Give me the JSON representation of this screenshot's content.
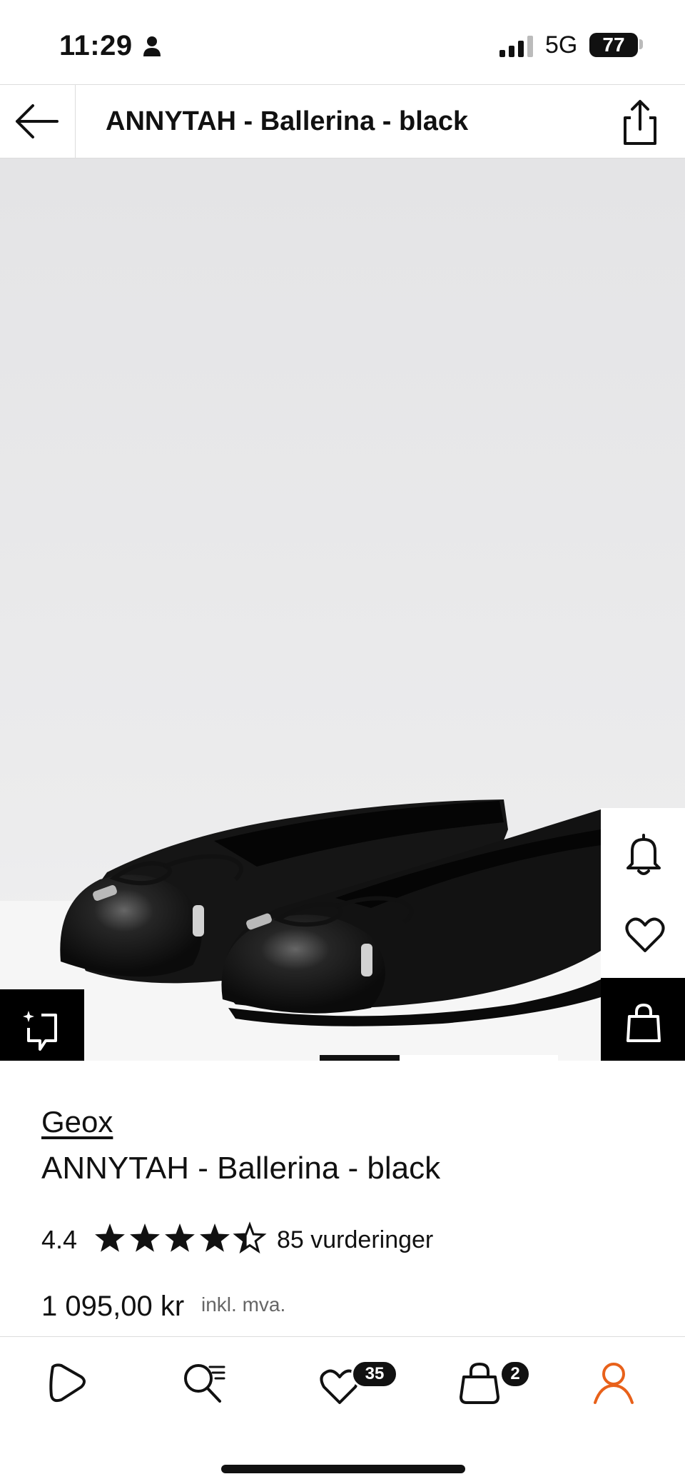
{
  "status_bar": {
    "time": "11:29",
    "network": "5G",
    "battery": "77",
    "icons": [
      "person-icon",
      "signal-icon",
      "battery-icon"
    ]
  },
  "header": {
    "title": "ANNYTAH - Ballerina - black",
    "icons": [
      "arrow-left-icon",
      "share-icon"
    ]
  },
  "gallery": {
    "image_subject": "black leather ballerina flats with bow",
    "side_icons": [
      "bell-icon",
      "heart-icon",
      "shopping-bag-icon"
    ],
    "overlay_icon": "visual-search-icon"
  },
  "product": {
    "brand": "Geox",
    "name": "ANNYTAH - Ballerina - black",
    "rating": "4.4",
    "rating_value": 4.4,
    "rating_max": 5,
    "review_count": "85 vurderinger",
    "price": "1 095,00 kr",
    "vat_note": "inkl. mva."
  },
  "tab_bar": {
    "tabs": [
      {
        "icon": "home-icon"
      },
      {
        "icon": "search-list-icon"
      },
      {
        "icon": "heart-icon",
        "badge": "35"
      },
      {
        "icon": "bag-icon",
        "badge": "2"
      },
      {
        "icon": "profile-icon",
        "active": true
      }
    ],
    "active_color": "#e8611a"
  }
}
